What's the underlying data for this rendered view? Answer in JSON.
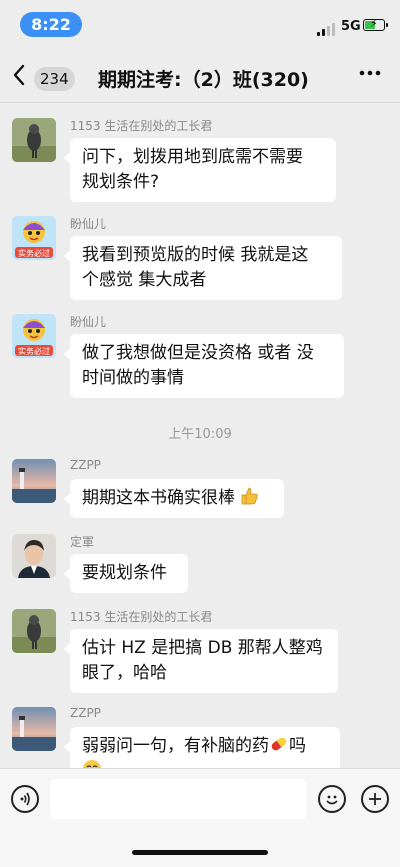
{
  "status_bar": {
    "time": "8:22",
    "network": "5G",
    "battery_level": 0.6,
    "accent_color": "#3b8ff5"
  },
  "nav": {
    "back_icon": "chevron-left-icon",
    "unread_count": "234",
    "title": "期期注考:（2）班(320)",
    "more_icon": "more-dots-icon"
  },
  "messages": [
    {
      "sender": "1153 生活在别处的工长君",
      "avatar": "bird-photo-avatar",
      "lines": [
        "问下，划拨用地到底需不需要",
        "规划条件?"
      ]
    },
    {
      "sender": "盼仙儿",
      "avatar": "cartoon-avatar",
      "avatar_caption": "实务必过",
      "lines": [
        "我看到预览版的时候 我就是这",
        "个感觉 集大成者"
      ]
    },
    {
      "sender": "盼仙儿",
      "avatar": "cartoon-avatar",
      "avatar_caption": "实务必过",
      "lines": [
        "做了我想做但是没资格 或者 没",
        "时间做的事情"
      ]
    },
    {
      "sender": "ZZPP",
      "avatar": "lighthouse-avatar",
      "lines": [
        "期期这本书确实很棒"
      ],
      "emoji": "thumbs-up-icon"
    },
    {
      "sender": "定軍",
      "avatar": "portrait-avatar",
      "lines": [
        "要规划条件"
      ]
    },
    {
      "sender": "1153 生活在别处的工长君",
      "avatar": "bird-photo-avatar",
      "lines": [
        "估计 HZ 是把搞 DB 那帮人整鸡",
        "眼了，哈哈"
      ]
    },
    {
      "sender": "ZZPP",
      "avatar": "lighthouse-avatar",
      "lines": [
        "弱弱问一句，有补脑的药",
        "吗"
      ],
      "emoji": "pill-icon",
      "emoji2": "laughing-crying-icon"
    }
  ],
  "timestamp": "上午10:09",
  "input_bar": {
    "voice_icon": "voice-icon",
    "emoji_icon": "smiley-icon",
    "plus_icon": "plus-icon",
    "placeholder": ""
  }
}
